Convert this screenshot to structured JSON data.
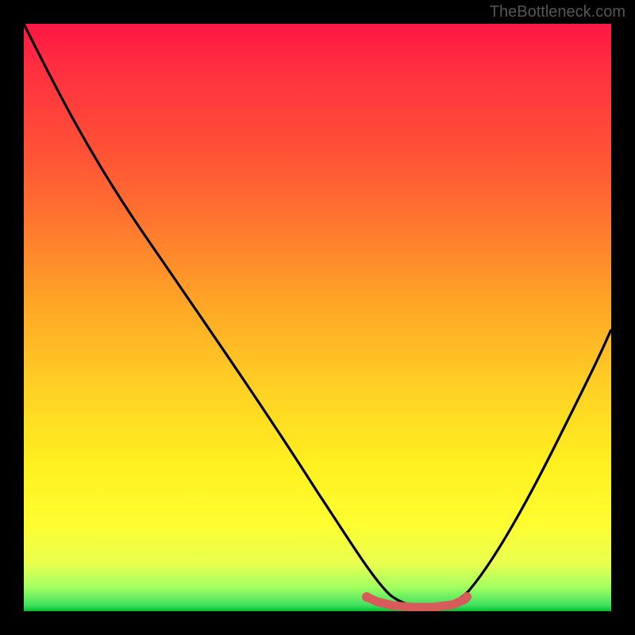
{
  "watermark": "TheBottleneck.com",
  "chart_data": {
    "type": "line",
    "title": "",
    "xlabel": "",
    "ylabel": "",
    "xlim": [
      0,
      100
    ],
    "ylim": [
      0,
      100
    ],
    "grid": false,
    "legend": false,
    "series": [
      {
        "name": "bottleneck-curve",
        "color": "#000000",
        "x": [
          0,
          10,
          20,
          30,
          40,
          50,
          58,
          62,
          66,
          70,
          75,
          80,
          88,
          95,
          100
        ],
        "values": [
          100,
          86,
          72,
          57,
          42,
          26,
          12,
          6,
          2,
          1,
          2,
          8,
          22,
          40,
          53
        ]
      },
      {
        "name": "highlight-band",
        "color": "#e06060",
        "type": "marker-band",
        "x_start": 58,
        "x_end": 75,
        "y": 1.8
      }
    ],
    "gradient_background": {
      "stops": [
        {
          "pos": 0,
          "color": "#ff1744"
        },
        {
          "pos": 22,
          "color": "#ff5236"
        },
        {
          "pos": 48,
          "color": "#ffa726"
        },
        {
          "pos": 75,
          "color": "#fff020"
        },
        {
          "pos": 96,
          "color": "#a0ff60"
        },
        {
          "pos": 100,
          "color": "#00c030"
        }
      ]
    }
  }
}
